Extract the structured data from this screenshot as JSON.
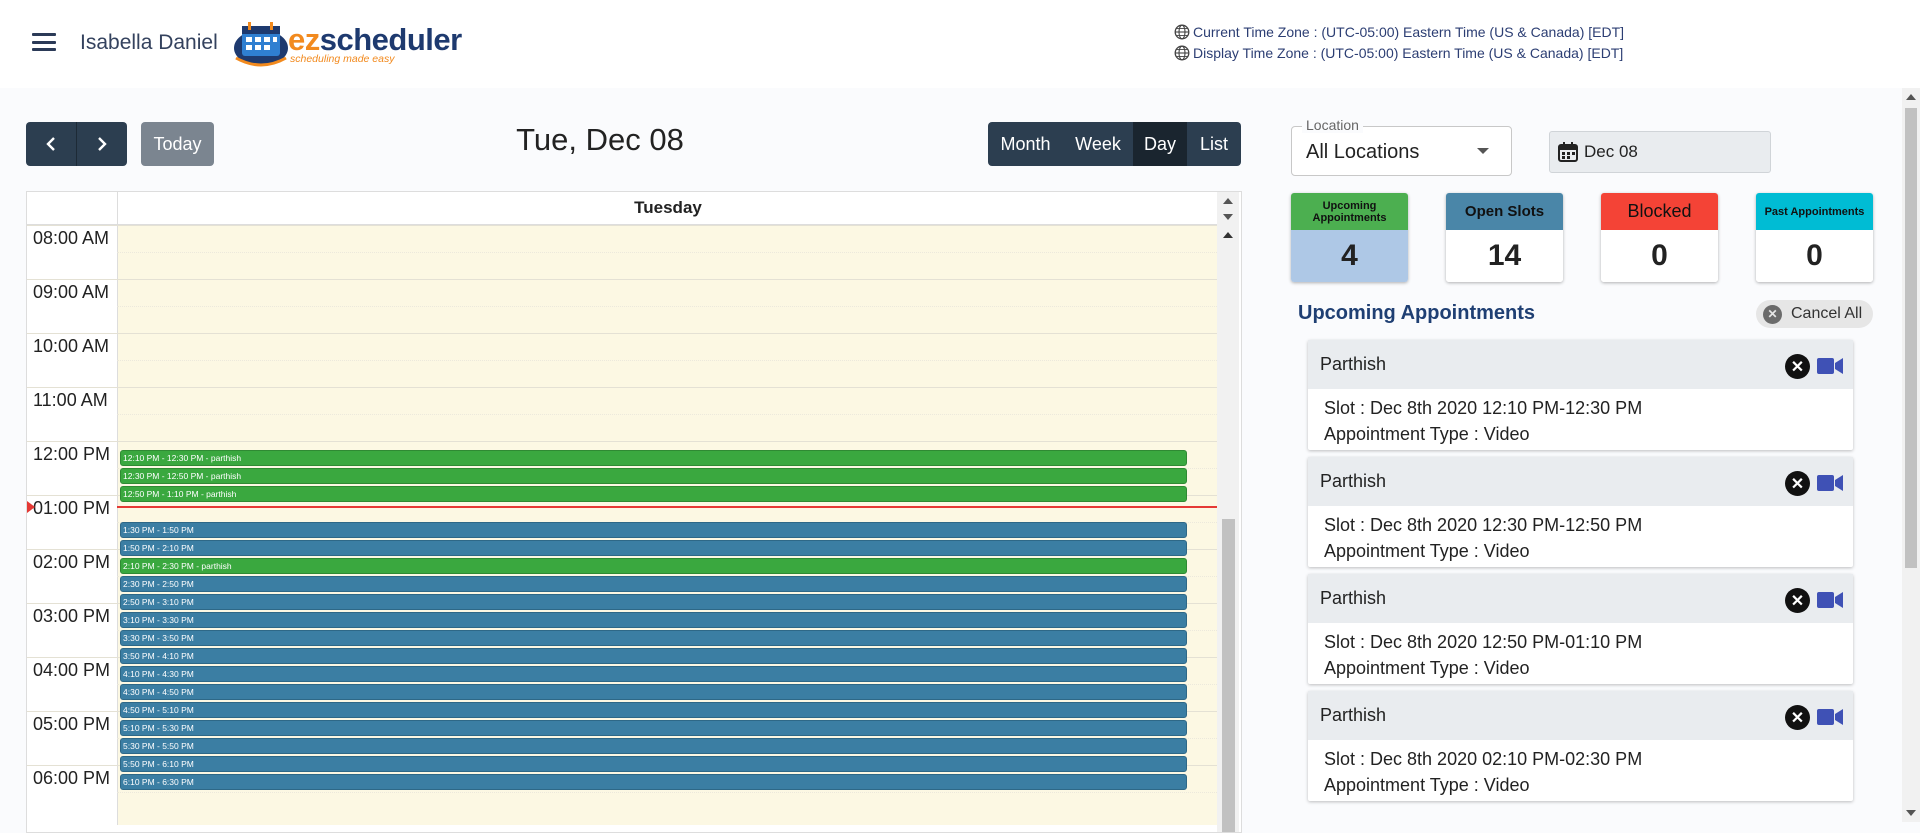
{
  "header": {
    "user_name": "Isabella Daniel",
    "logo_ez": "ez",
    "logo_scheduler": "scheduler",
    "logo_tagline": "scheduling made easy",
    "current_tz": "Current Time Zone : (UTC-05:00) Eastern Time (US & Canada) [EDT]",
    "display_tz": "Display Time Zone : (UTC-05:00) Eastern Time (US & Canada) [EDT]"
  },
  "toolbar": {
    "prev_icon": "chevron-left-icon",
    "next_icon": "chevron-right-icon",
    "today_label": "Today",
    "title": "Tue, Dec 08",
    "views": [
      "Month",
      "Week",
      "Day",
      "List"
    ],
    "active_view": "Day"
  },
  "calendar": {
    "day_header": "Tuesday",
    "hours": [
      "08:00 AM",
      "09:00 AM",
      "10:00 AM",
      "11:00 AM",
      "12:00 PM",
      "01:00 PM",
      "02:00 PM",
      "03:00 PM",
      "04:00 PM",
      "05:00 PM",
      "06:00 PM"
    ],
    "events": [
      {
        "label": "12:10 PM - 12:30 PM - parthish",
        "status": "booked"
      },
      {
        "label": "12:30 PM - 12:50 PM - parthish",
        "status": "booked"
      },
      {
        "label": "12:50 PM - 1:10 PM - parthish",
        "status": "booked"
      },
      {
        "label": "1:30 PM - 1:50 PM",
        "status": "open"
      },
      {
        "label": "1:50 PM - 2:10 PM",
        "status": "open"
      },
      {
        "label": "2:10 PM - 2:30 PM - parthish",
        "status": "booked"
      },
      {
        "label": "2:30 PM - 2:50 PM",
        "status": "open"
      },
      {
        "label": "2:50 PM - 3:10 PM",
        "status": "open"
      },
      {
        "label": "3:10 PM - 3:30 PM",
        "status": "open"
      },
      {
        "label": "3:30 PM - 3:50 PM",
        "status": "open"
      },
      {
        "label": "3:50 PM - 4:10 PM",
        "status": "open"
      },
      {
        "label": "4:10 PM - 4:30 PM",
        "status": "open"
      },
      {
        "label": "4:30 PM - 4:50 PM",
        "status": "open"
      },
      {
        "label": "4:50 PM - 5:10 PM",
        "status": "open"
      },
      {
        "label": "5:10 PM - 5:30 PM",
        "status": "open"
      },
      {
        "label": "5:30 PM - 5:50 PM",
        "status": "open"
      },
      {
        "label": "5:50 PM - 6:10 PM",
        "status": "open"
      },
      {
        "label": "6:10 PM - 6:30 PM",
        "status": "open"
      }
    ],
    "colors": {
      "booked": "#3aa83f",
      "open": "#3b7ea3",
      "now_line": "#e53935",
      "day_bg": "#fcf8e3"
    }
  },
  "filters": {
    "location_legend": "Location",
    "location_value": "All Locations",
    "date_value": "Dec 08"
  },
  "stats": [
    {
      "label": "Upcoming Appointments",
      "count": "4",
      "header_color": "#4caf50",
      "body_color": "#aec8e6"
    },
    {
      "label": "Open Slots",
      "count": "14",
      "header_color": "#4a86a8",
      "body_color": "#ffffff"
    },
    {
      "label": "Blocked",
      "count": "0",
      "header_color": "#f44336",
      "body_color": "#ffffff"
    },
    {
      "label": "Past Appointments",
      "count": "0",
      "header_color": "#00bcd4",
      "body_color": "#ffffff"
    }
  ],
  "upcoming": {
    "title": "Upcoming Appointments",
    "cancel_all_label": "Cancel All",
    "items": [
      {
        "name": "Parthish",
        "slot": "Slot : Dec 8th 2020 12:10 PM-12:30 PM",
        "type": "Appointment Type : Video"
      },
      {
        "name": "Parthish",
        "slot": "Slot : Dec 8th 2020 12:30 PM-12:50 PM",
        "type": "Appointment Type : Video"
      },
      {
        "name": "Parthish",
        "slot": "Slot : Dec 8th 2020 12:50 PM-01:10 PM",
        "type": "Appointment Type : Video"
      },
      {
        "name": "Parthish",
        "slot": "Slot : Dec 8th 2020 02:10 PM-02:30 PM",
        "type": "Appointment Type : Video"
      }
    ]
  }
}
